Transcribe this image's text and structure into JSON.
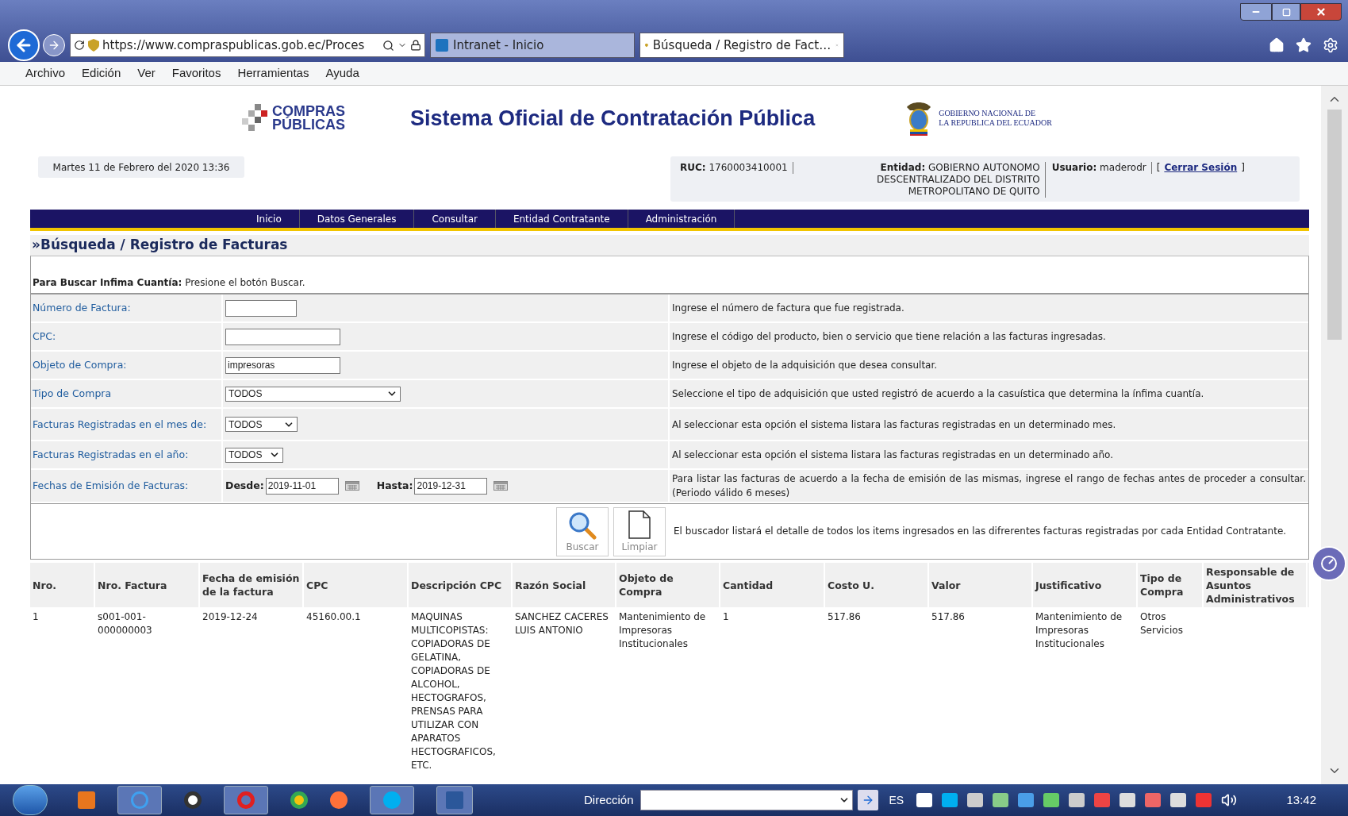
{
  "browser": {
    "address": "https://www.compraspublicas.gob.ec/Proces",
    "tabs": [
      {
        "label": "Intranet - Inicio",
        "selected": false
      },
      {
        "label": "Búsqueda / Registro de Fact…",
        "selected": true
      }
    ]
  },
  "menu": [
    "Archivo",
    "Edición",
    "Ver",
    "Favoritos",
    "Herramientas",
    "Ayuda"
  ],
  "header": {
    "logo_text": [
      "COMPRAS",
      "PÚBLICAS"
    ],
    "title": "Sistema Oficial de Contratación Pública",
    "government": [
      "GOBIERNO NACIONAL DE",
      "LA REPUBLICA DEL ECUADOR"
    ]
  },
  "session": {
    "date": "Martes 11 de Febrero del 2020 13:36",
    "ruc": "**RUC:** 1760003410001",
    "entity": "**Entidad:** GOBIERNO AUTONOMO DESCENTRALIZADO DEL DISTRITO METROPOLITANO DE QUITO",
    "user": "**Usuario:** maderodr",
    "bracket_open": "[",
    "logout": "Cerrar Sesión",
    "bracket_close": "]"
  },
  "nav": [
    "Inicio",
    "Datos Generales",
    "Consultar",
    "Entidad Contratante",
    "Administración"
  ],
  "page_title": "»Búsqueda / Registro de Facturas",
  "form": {
    "intro": "**Para Buscar Infima Cuantía:** Presione el botón Buscar.",
    "rows": [
      {
        "kind": "text",
        "label": "Número de Factura:",
        "help": "Ingrese el número de factura que fue registrada."
      },
      {
        "kind": "text",
        "label": "CPC:",
        "help": "Ingrese el código del producto, bien o servicio que tiene relación a las facturas ingresadas."
      },
      {
        "kind": "text",
        "label": "Objeto de Compra:",
        "value": "impresoras",
        "help": "Ingrese el objeto de la adquisición que desea consultar."
      },
      {
        "kind": "select",
        "label": "Tipo de Compra",
        "value": "TODOS",
        "help": "Seleccione el tipo de adquisición que usted registró de acuerdo a la casuística que determina la ínfima cuantía."
      },
      {
        "kind": "select",
        "label": "Facturas Registradas en el mes de:",
        "value": "TODOS",
        "help": "Al seleccionar esta opción el sistema listara las facturas registradas en un determinado mes."
      },
      {
        "kind": "select",
        "label": "Facturas Registradas en el año:",
        "value": "TODOS",
        "help": "Al seleccionar esta opción el sistema listara las facturas registradas en un determinado año."
      },
      {
        "kind": "daterange",
        "label": "Fechas de Emisión de Facturas:",
        "from_label": "Desde:",
        "from": "2019-11-01",
        "to_label": "Hasta:",
        "to": "2019-12-31",
        "help": "Para listar las facturas de acuerdo a la fecha de emisión de las mismas, ingrese el rango de fechas antes de proceder a consultar.(Periodo válido 6 meses)"
      }
    ],
    "buttons": [
      {
        "kind": "search",
        "label": "Buscar"
      },
      {
        "kind": "clear",
        "label": "Limpiar"
      }
    ],
    "buttons_help": "El buscador listará el detalle de todos los items ingresados en las difrerentes facturas registradas por cada Entidad Contratante."
  },
  "table": {
    "columns": [
      "Nro.",
      "Nro. Factura",
      "Fecha de emisión de la factura",
      "CPC",
      "Descripción CPC",
      "Razón Social",
      "Objeto de Compra",
      "Cantidad",
      "Costo U.",
      "Valor",
      "Justificativo",
      "Tipo de Compra",
      "Responsable de Asuntos Administrativos"
    ],
    "rows": [
      [
        "1",
        "s001-001-000000003",
        "2019-12-24",
        "45160.00.1",
        "MAQUINAS MULTICOPISTAS: COPIADORAS DE GELATINA, COPIADORAS DE ALCOHOL, HECTOGRAFOS, PRENSAS PARA UTILIZAR CON APARATOS HECTOGRAFICOS, ETC.",
        "SANCHEZ CACERES LUIS ANTONIO",
        "Mantenimiento de Impresoras Institucionales",
        "1",
        "517.86",
        "517.86",
        "Mantenimiento de Impresoras Institucionales",
        "Otros Servicios"
      ]
    ]
  },
  "taskbar": {
    "address_label": "Dirección",
    "language": "ES",
    "clock": "13:42"
  }
}
